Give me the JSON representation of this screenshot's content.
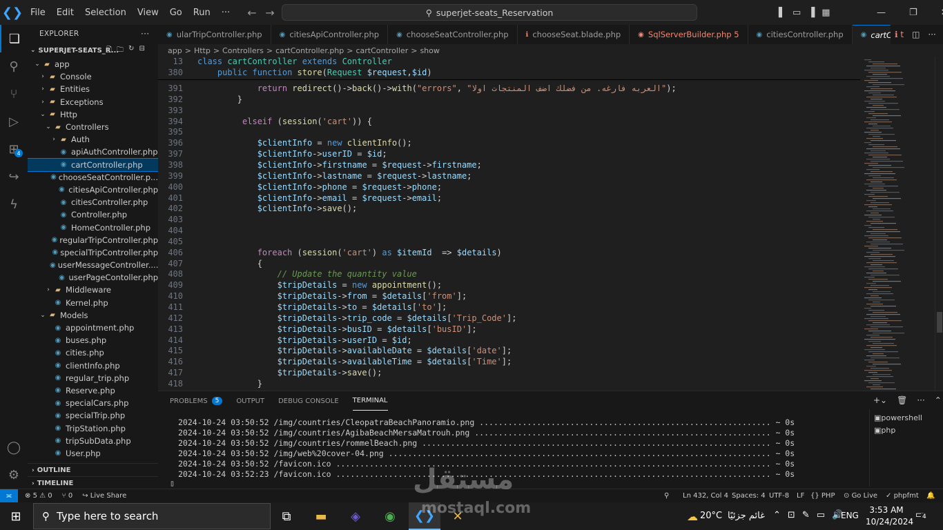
{
  "titlebar": {
    "menus": [
      "File",
      "Edit",
      "Selection",
      "View",
      "Go",
      "Run",
      "···"
    ],
    "search": "superjet-seats_Reservation"
  },
  "explorer": {
    "title": "EXPLORER",
    "project": "SUPERJET-SEATS_R...",
    "tree": [
      {
        "label": "app",
        "depth": 0,
        "type": "folder",
        "open": true
      },
      {
        "label": "Console",
        "depth": 1,
        "type": "folder",
        "open": false
      },
      {
        "label": "Entities",
        "depth": 1,
        "type": "folder",
        "open": false
      },
      {
        "label": "Exceptions",
        "depth": 1,
        "type": "folder",
        "open": false
      },
      {
        "label": "Http",
        "depth": 1,
        "type": "folder",
        "open": true
      },
      {
        "label": "Controllers",
        "depth": 2,
        "type": "folder",
        "open": true
      },
      {
        "label": "Auth",
        "depth": 3,
        "type": "folder",
        "open": false
      },
      {
        "label": "apiAuthController.php",
        "depth": 3,
        "type": "php"
      },
      {
        "label": "cartController.php",
        "depth": 3,
        "type": "php",
        "selected": true
      },
      {
        "label": "chooseSeatController.p...",
        "depth": 3,
        "type": "php"
      },
      {
        "label": "citiesApiController.php",
        "depth": 3,
        "type": "php"
      },
      {
        "label": "citiesController.php",
        "depth": 3,
        "type": "php"
      },
      {
        "label": "Controller.php",
        "depth": 3,
        "type": "php"
      },
      {
        "label": "HomeController.php",
        "depth": 3,
        "type": "php"
      },
      {
        "label": "regularTripController.php",
        "depth": 3,
        "type": "php"
      },
      {
        "label": "specialTripController.php",
        "depth": 3,
        "type": "php"
      },
      {
        "label": "userMessageController....",
        "depth": 3,
        "type": "php"
      },
      {
        "label": "userPageContoller.php",
        "depth": 3,
        "type": "php"
      },
      {
        "label": "Middleware",
        "depth": 2,
        "type": "folder",
        "open": false
      },
      {
        "label": "Kernel.php",
        "depth": 2,
        "type": "php"
      },
      {
        "label": "Models",
        "depth": 1,
        "type": "folder",
        "open": true
      },
      {
        "label": "appointment.php",
        "depth": 2,
        "type": "php"
      },
      {
        "label": "buses.php",
        "depth": 2,
        "type": "php"
      },
      {
        "label": "cities.php",
        "depth": 2,
        "type": "php"
      },
      {
        "label": "clientInfo.php",
        "depth": 2,
        "type": "php"
      },
      {
        "label": "regular_trip.php",
        "depth": 2,
        "type": "php"
      },
      {
        "label": "Reserve.php",
        "depth": 2,
        "type": "php"
      },
      {
        "label": "specialCars.php",
        "depth": 2,
        "type": "php"
      },
      {
        "label": "specialTrip.php",
        "depth": 2,
        "type": "php"
      },
      {
        "label": "TripStation.php",
        "depth": 2,
        "type": "php"
      },
      {
        "label": "tripSubData.php",
        "depth": 2,
        "type": "php"
      },
      {
        "label": "User.php",
        "depth": 2,
        "type": "php"
      }
    ],
    "outline": "OUTLINE",
    "timeline": "TIMELINE"
  },
  "tabs": [
    {
      "label": "ularTripController.php",
      "kind": "php"
    },
    {
      "label": "citiesApiController.php",
      "kind": "php"
    },
    {
      "label": "chooseSeatController.php",
      "kind": "php"
    },
    {
      "label": "chooseSeat.blade.php",
      "kind": "blade"
    },
    {
      "label": "SqlServerBuilder.php 5",
      "kind": "err"
    },
    {
      "label": "citiesController.php",
      "kind": "php"
    },
    {
      "label": "cartController.php",
      "kind": "php",
      "active": true
    }
  ],
  "breadcrumb": [
    "app",
    ">",
    "Http",
    ">",
    "Controllers",
    ">",
    "cartController.php",
    ">",
    "cartController",
    ">",
    "show"
  ],
  "sticky": [
    {
      "n": "13",
      "html": "<span class='k'>class</span> <span class='t'>cartController</span> <span class='k'>extends</span> <span class='t'>Controller</span>"
    },
    {
      "n": "380",
      "html": "    <span class='k'>public</span> <span class='k'>function</span> <span class='f'>store</span>(<span class='t'>Request</span> <span class='v'>$request</span>,<span class='v'>$id</span>)"
    }
  ],
  "code": [
    {
      "n": "391",
      "html": "            <span class='kc'>return</span> <span class='f'>redirect</span>()-><span class='f'>back</span>()-><span class='f'>with</span>(<span class='s'>\"errors\"</span>, <span class='s'>\"العربه فارغه. من فضلك اضف المنتجات اولا\"</span>);"
    },
    {
      "n": "392",
      "html": "        }"
    },
    {
      "n": "393",
      "html": ""
    },
    {
      "n": "394",
      "html": "         <span class='kc'>elseif</span> (<span class='f'>session</span>(<span class='s'>'cart'</span>)) {"
    },
    {
      "n": "395",
      "html": ""
    },
    {
      "n": "396",
      "html": "            <span class='v'>$clientInfo</span> = <span class='k'>new</span> <span class='f'>clientInfo</span>();"
    },
    {
      "n": "397",
      "html": "            <span class='v'>$clientInfo</span>-><span class='v'>userID</span> = <span class='v'>$id</span>;"
    },
    {
      "n": "398",
      "html": "            <span class='v'>$clientInfo</span>-><span class='v'>firstname</span> = <span class='v'>$request</span>-><span class='v'>firstname</span>;"
    },
    {
      "n": "399",
      "html": "            <span class='v'>$clientInfo</span>-><span class='v'>lastname</span> = <span class='v'>$request</span>-><span class='v'>lastname</span>;"
    },
    {
      "n": "400",
      "html": "            <span class='v'>$clientInfo</span>-><span class='v'>phone</span> = <span class='v'>$request</span>-><span class='v'>phone</span>;"
    },
    {
      "n": "401",
      "html": "            <span class='v'>$clientInfo</span>-><span class='v'>email</span> = <span class='v'>$request</span>-><span class='v'>email</span>;"
    },
    {
      "n": "402",
      "html": "            <span class='v'>$clientInfo</span>-><span class='f'>save</span>();"
    },
    {
      "n": "403",
      "html": ""
    },
    {
      "n": "404",
      "html": ""
    },
    {
      "n": "405",
      "html": ""
    },
    {
      "n": "406",
      "html": "            <span class='kc'>foreach</span> (<span class='f'>session</span>(<span class='s'>'cart'</span>) <span class='k'>as</span> <span class='v'>$itemId</span>  => <span class='v'>$details</span>)"
    },
    {
      "n": "407",
      "html": "            {"
    },
    {
      "n": "408",
      "html": "                <span class='c'>// Update the quantity value</span>"
    },
    {
      "n": "409",
      "html": "                <span class='v'>$tripDetails</span> = <span class='k'>new</span> <span class='f'>appointment</span>();"
    },
    {
      "n": "410",
      "html": "                <span class='v'>$tripDetails</span>-><span class='v'>from</span> = <span class='v'>$details</span>[<span class='s'>'from'</span>];"
    },
    {
      "n": "411",
      "html": "                <span class='v'>$tripDetails</span>-><span class='v'>to</span> = <span class='v'>$details</span>[<span class='s'>'to'</span>];"
    },
    {
      "n": "412",
      "html": "                <span class='v'>$tripDetails</span>-><span class='v'>trip_code</span> = <span class='v'>$details</span>[<span class='s'>'Trip_Code'</span>];"
    },
    {
      "n": "413",
      "html": "                <span class='v'>$tripDetails</span>-><span class='v'>busID</span> = <span class='v'>$details</span>[<span class='s'>'busID'</span>];"
    },
    {
      "n": "414",
      "html": "                <span class='v'>$tripDetails</span>-><span class='v'>userID</span> = <span class='v'>$id</span>;"
    },
    {
      "n": "415",
      "html": "                <span class='v'>$tripDetails</span>-><span class='v'>availableDate</span> = <span class='v'>$details</span>[<span class='s'>'date'</span>];"
    },
    {
      "n": "416",
      "html": "                <span class='v'>$tripDetails</span>-><span class='v'>availableTime</span> = <span class='v'>$details</span>[<span class='s'>'Time'</span>];"
    },
    {
      "n": "417",
      "html": "                <span class='v'>$tripDetails</span>-><span class='f'>save</span>();"
    },
    {
      "n": "418",
      "html": "            }"
    }
  ],
  "panel": {
    "tabs": [
      "PROBLEMS",
      "OUTPUT",
      "DEBUG CONSOLE",
      "TERMINAL"
    ],
    "problems_count": "5",
    "active": "TERMINAL",
    "lines": [
      "2024-10-24 03:50:52 /img/countries/CleopatraBeachPanoramio.png ............................................................. ~ 0s",
      "2024-10-24 03:50:52 /img/countries/AgibaBeachMersaMatrouh.png .............................................................. ~ 0s",
      "2024-10-24 03:50:52 /img/countries/rommelBeach.png ......................................................................... ~ 0s",
      "2024-10-24 03:50:52 /img/web%20cover-04.png ................................................................................ ~ 0s",
      "2024-10-24 03:50:52 /favicon.ico ........................................................................................... ~ 0s",
      "2024-10-24 03:52:23 /favicon.ico ........................................................................................... ~ 0s"
    ],
    "terminals": [
      "powershell",
      "php"
    ]
  },
  "status": {
    "errors": "5",
    "warnings": "0",
    "ports": "0",
    "liveshare": "Live Share",
    "position": "Ln 432, Col 4",
    "spaces": "Spaces: 4",
    "encoding": "UTF-8",
    "eol": "LF",
    "lang": "PHP",
    "golive": "Go Live",
    "fmt": "phpfmt"
  },
  "taskbar": {
    "search": "Type here to search",
    "weather": "20°C",
    "weather_text": "غائم جزئيًا",
    "lang": "ENG",
    "time": "3:53 AM",
    "date": "10/24/2024",
    "notif": "4"
  },
  "watermark": {
    "ar": "مستقل",
    "en": "mostaql.com"
  }
}
